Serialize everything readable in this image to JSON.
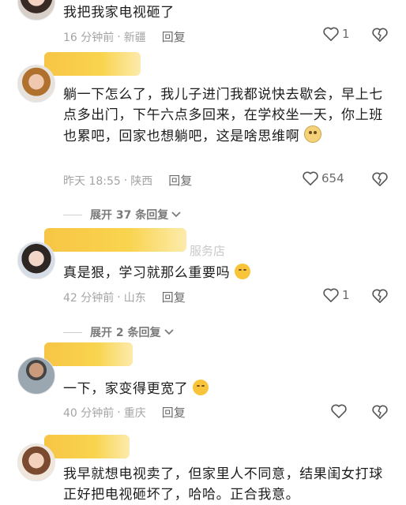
{
  "comments": [
    {
      "text": "我把我家电视砸了",
      "time": "16 分钟前",
      "location": "新疆",
      "reply": "回复",
      "likes": "1"
    },
    {
      "text": "躺一下怎么了，我儿子进门我都说快去歇会，早上七点多出门，下午六点多回来，在学校坐一天，你上班也累吧，回家也想躺吧，这是啥思维啊",
      "emoji": "dizzy-emoji",
      "time": "昨天 18:55",
      "location": "陕西",
      "reply": "回复",
      "likes": "654",
      "expand": "展开 37 条回复"
    },
    {
      "name_fragment": "服务店",
      "text": "真是狠，学习就那么重要吗",
      "emoji": "laughing-emoji",
      "time": "42 分钟前",
      "location": "山东",
      "reply": "回复",
      "likes": "1",
      "expand": "展开 2 条回复"
    },
    {
      "text": "一下，家变得更宽了",
      "emoji": "laughing-emoji",
      "time": "40 分钟前",
      "location": "重庆",
      "reply": "回复",
      "likes": ""
    },
    {
      "text": "我早就想电视卖了，但家里人不同意，结果闺女打球正好把电视砸坏了，哈哈。正合我意。"
    }
  ],
  "separator": "·",
  "icons": {
    "like": "heart-outline-icon",
    "dislike": "broken-heart-icon",
    "chevron": "chevron-down-icon"
  }
}
